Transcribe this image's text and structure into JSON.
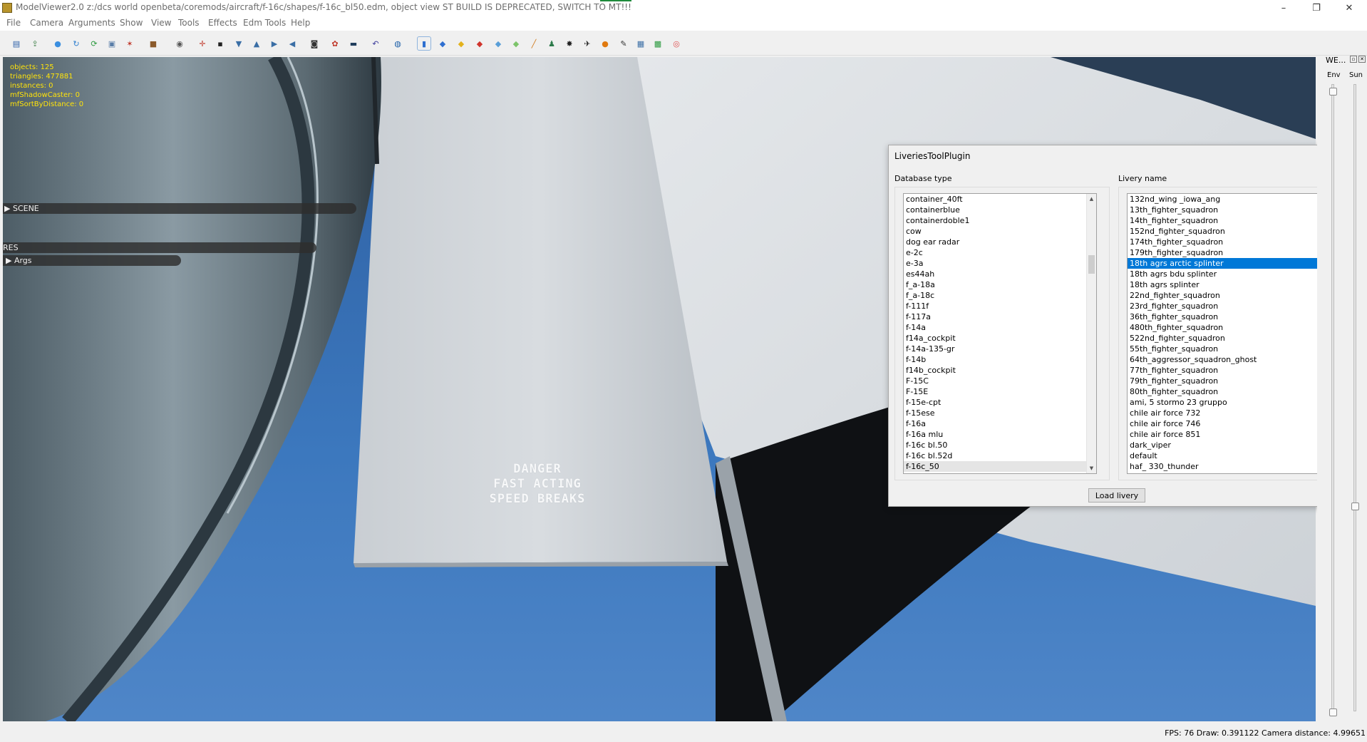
{
  "window": {
    "title": "ModelViewer2.0 z:/dcs world openbeta/coremods/aircraft/f-16c/shapes/f-16c_bl50.edm, object view ST BUILD IS DEPRECATED, SWITCH TO MT!!!",
    "minimize": "–",
    "maximize": "❐",
    "close": "✕"
  },
  "menu": [
    "File",
    "Camera",
    "Arguments",
    "Show",
    "View",
    "Tools",
    "Effects",
    "Edm Tools",
    "Help"
  ],
  "toolbar_icons": [
    {
      "name": "save-icon",
      "color": "#2b5fa8",
      "glyph": "▤"
    },
    {
      "name": "export-icon",
      "color": "#3a7d44",
      "glyph": "⇪"
    },
    {
      "name": "sphere-icon",
      "color": "#3b8fe0",
      "glyph": "●"
    },
    {
      "name": "refresh-icon",
      "color": "#2f7fcf",
      "glyph": "↻"
    },
    {
      "name": "reload-icon",
      "color": "#2c9a3f",
      "glyph": "⟳"
    },
    {
      "name": "image-icon",
      "color": "#5a7ea8",
      "glyph": "▣"
    },
    {
      "name": "skeleton-icon",
      "color": "#c0392b",
      "glyph": "✶"
    },
    {
      "name": "box-icon",
      "color": "#8b5a2b",
      "glyph": "■"
    },
    {
      "name": "camera-icon",
      "color": "#555555",
      "glyph": "◉"
    },
    {
      "name": "axis-icon",
      "color": "#c0392b",
      "glyph": "✛"
    },
    {
      "name": "grid-dot-icon",
      "color": "#222222",
      "glyph": "▪"
    },
    {
      "name": "light-icon",
      "color": "#3a6ea5",
      "glyph": "▼"
    },
    {
      "name": "lamp-icon",
      "color": "#3a6ea5",
      "glyph": "▲"
    },
    {
      "name": "arrow-right-icon",
      "color": "#3a6ea5",
      "glyph": "▶"
    },
    {
      "name": "arrow-left-icon",
      "color": "#3a6ea5",
      "glyph": "◀"
    },
    {
      "name": "portrait-icon",
      "color": "#333333",
      "glyph": "◙"
    },
    {
      "name": "colors-icon",
      "color": "#c0392b",
      "glyph": "✿"
    },
    {
      "name": "monitor-icon",
      "color": "#1f3d5c",
      "glyph": "▬"
    },
    {
      "name": "undo-icon",
      "color": "#3a3a9a",
      "glyph": "↶"
    },
    {
      "name": "reset-icon",
      "color": "#1c5fa8",
      "glyph": "◍"
    },
    {
      "name": "chart-icon",
      "color": "#2f6fd0",
      "glyph": "▮"
    },
    {
      "name": "cube-blue-icon",
      "color": "#2f6fd0",
      "glyph": "◆"
    },
    {
      "name": "cube-yellow-icon",
      "color": "#e3b21c",
      "glyph": "◆"
    },
    {
      "name": "cube-red-icon",
      "color": "#d0342c",
      "glyph": "◆"
    },
    {
      "name": "cube-light-icon",
      "color": "#5a9fd8",
      "glyph": "◆"
    },
    {
      "name": "cube-green-icon",
      "color": "#7cc46a",
      "glyph": "◆"
    },
    {
      "name": "graph-icon",
      "color": "#d07a1c",
      "glyph": "╱"
    },
    {
      "name": "figure-icon",
      "color": "#2c7a4a",
      "glyph": "♟"
    },
    {
      "name": "particles-icon",
      "color": "#222222",
      "glyph": "✸"
    },
    {
      "name": "plane-icon",
      "color": "#222222",
      "glyph": "✈"
    },
    {
      "name": "fire-icon",
      "color": "#e07a10",
      "glyph": "●"
    },
    {
      "name": "note-icon",
      "color": "#333333",
      "glyph": "✎"
    },
    {
      "name": "table-icon",
      "color": "#3a6ea5",
      "glyph": "▦"
    },
    {
      "name": "grid-icon",
      "color": "#2c9a3f",
      "glyph": "▩"
    },
    {
      "name": "record-icon",
      "color": "#e05050",
      "glyph": "◎"
    }
  ],
  "stats": {
    "objects": "objects: 125",
    "triangles": "triangles: 477881",
    "instances": "instances: 0",
    "shadow": "mfShadowCaster: 0",
    "sort": "mfSortByDistance: 0"
  },
  "overlay": {
    "scene": "▶ SCENE",
    "res": "RES",
    "args": "▶ Args"
  },
  "decal": {
    "line1": "DANGER",
    "line2": "FAST ACTING",
    "line3": "SPEED BREAKS"
  },
  "dialog": {
    "title": "LiveriesToolPlugin",
    "close": "x",
    "db_label": "Database type",
    "livery_label": "Livery name",
    "load_button": "Load livery",
    "database_types": [
      "container_40ft",
      "containerblue",
      "containerdoble1",
      "cow",
      "dog ear radar",
      "e-2c",
      "e-3a",
      "es44ah",
      "f_a-18a",
      "f_a-18c",
      "f-111f",
      "f-117a",
      "f-14a",
      "f14a_cockpit",
      "f-14a-135-gr",
      "f-14b",
      "f14b_cockpit",
      "F-15C",
      "F-15E",
      "f-15e-cpt",
      "f-15ese",
      "f-16a",
      "f-16a mlu",
      "f-16c bl.50",
      "f-16c bl.52d",
      "f-16c_50"
    ],
    "db_selected_index": 25,
    "liveries": [
      "132nd_wing _iowa_ang",
      "13th_fighter_squadron",
      "14th_fighter_squadron",
      "152nd_fighter_squadron",
      "174th_fighter_squadron",
      "179th_fighter_squadron",
      "18th agrs arctic splinter",
      "18th agrs bdu splinter",
      "18th agrs splinter",
      "22nd_fighter_squadron",
      "23rd_fighter_squadron",
      "36th_fighter_squadron",
      "480th_fighter_squadron",
      "522nd_fighter_squadron",
      "55th_fighter_squadron",
      "64th_aggressor_squadron_ghost",
      "77th_fighter_squadron",
      "79th_fighter_squadron",
      "80th_fighter_squadron",
      "ami, 5 stormo 23 gruppo",
      "chile air force 732",
      "chile air force 746",
      "chile air force 851",
      "dark_viper",
      "default",
      "haf_ 330_thunder"
    ],
    "livery_selected_index": 6
  },
  "right_panel": {
    "title": "WE...",
    "env": "Env",
    "sun": "Sun",
    "restore": "▫",
    "close": "✕"
  },
  "status": "FPS: 76  Draw: 0.391122  Camera distance: 4.99651"
}
